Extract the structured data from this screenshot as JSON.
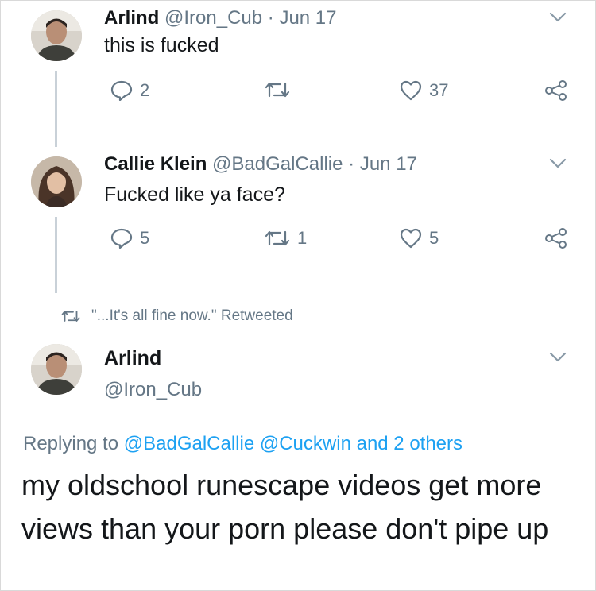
{
  "tweet1": {
    "name": "Arlind",
    "handle": "@Iron_Cub",
    "separator": "·",
    "date": "Jun 17",
    "text": "this is fucked",
    "reply_count": "2",
    "retweet_count": "",
    "like_count": "37"
  },
  "tweet2": {
    "name": "Callie Klein",
    "handle": "@BadGalCallie",
    "separator": "·",
    "date": "Jun 17",
    "text": "Fucked like ya face?",
    "reply_count": "5",
    "retweet_count": "1",
    "like_count": "5"
  },
  "retweet_note": {
    "text": "\"...It's all fine now.\" Retweeted"
  },
  "tweet3": {
    "name": "Arlind",
    "handle": "@Iron_Cub",
    "replying_prefix": "Replying to",
    "replying_user1": "@BadGalCallie",
    "replying_user2": "@Cuckwin",
    "replying_suffix": "and 2 others",
    "text": "my oldschool runescape videos get more views than your porn please don't pipe up"
  },
  "colors": {
    "text": "#14171a",
    "muted": "#657786",
    "link": "#1da1f2",
    "thread_line": "#c9d1d8"
  }
}
